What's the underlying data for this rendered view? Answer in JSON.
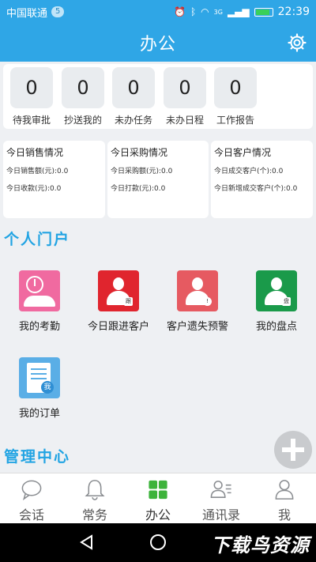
{
  "status_bar": {
    "carrier": "中国联通",
    "badge": "5",
    "signal": "3G",
    "time": "22:39"
  },
  "header": {
    "title": "办公"
  },
  "counters": [
    {
      "value": "0",
      "label": "待我审批"
    },
    {
      "value": "0",
      "label": "抄送我的"
    },
    {
      "value": "0",
      "label": "未办任务"
    },
    {
      "value": "0",
      "label": "未办日程"
    },
    {
      "value": "0",
      "label": "工作报告"
    }
  ],
  "stats": [
    {
      "title": "今日销售情况",
      "lines": [
        "今日销售额(元):0.0",
        "今日收款(元):0.0"
      ]
    },
    {
      "title": "今日采购情况",
      "lines": [
        "今日采购额(元):0.0",
        "今日打款(元):0.0"
      ]
    },
    {
      "title": "今日客户情况",
      "lines": [
        "今日成交客户(个):0.0",
        "今日新增成交客户(个):0.0"
      ]
    }
  ],
  "personal": {
    "title": "个人门户",
    "tiles": [
      {
        "label": "我的考勤",
        "icon": "clock-person-icon",
        "color": "#f06aa0"
      },
      {
        "label": "今日跟进客户",
        "icon": "person-follow-icon",
        "color": "#e0252e",
        "tag": "跟"
      },
      {
        "label": "客户遗失预警",
        "icon": "person-warning-icon",
        "color": "#e65a61",
        "tag": "!"
      },
      {
        "label": "我的盘点",
        "icon": "person-inventory-icon",
        "color": "#1a9a4a",
        "tag": "盘"
      },
      {
        "label": "我的订单",
        "icon": "order-document-icon",
        "color": "#5aaee6",
        "tag": "我"
      }
    ]
  },
  "management": {
    "title": "管理中心"
  },
  "tabs": [
    {
      "label": "会话",
      "icon": "chat-bubble-icon"
    },
    {
      "label": "常务",
      "icon": "bell-icon"
    },
    {
      "label": "办公",
      "icon": "grid-icon",
      "active": true
    },
    {
      "label": "通讯录",
      "icon": "contacts-icon"
    },
    {
      "label": "我",
      "icon": "user-icon"
    }
  ],
  "watermark": "下载鸟资源"
}
